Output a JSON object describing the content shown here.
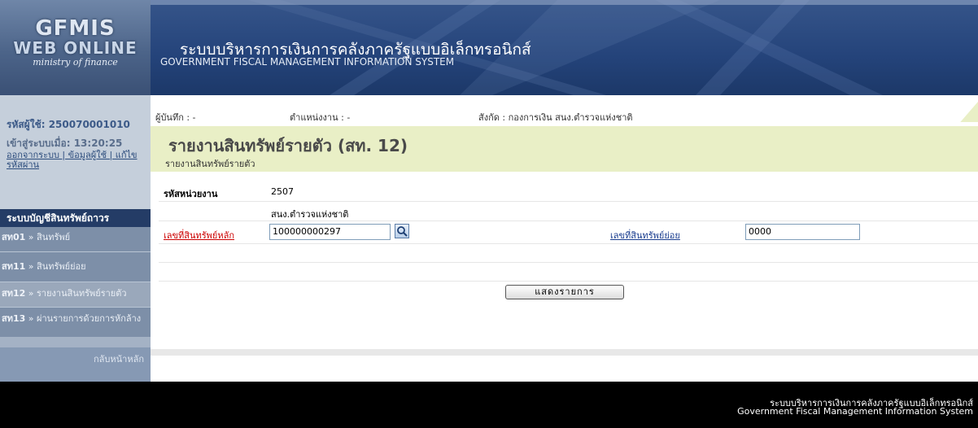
{
  "logo": {
    "line1": "GFMIS",
    "line2": "WEB ONLINE",
    "line3": "ministry of finance"
  },
  "banner": {
    "title_th": "ระบบบริหารการเงินการคลังภาครัฐแบบอิเล็กทรอนิกส์",
    "title_en": "GOVERNMENT FISCAL MANAGEMENT INFORMATION SYSTEM"
  },
  "user": {
    "id_label": "รหัสผู้ใช้: 250070001010",
    "login_label": "เข้าสู่ระบบเมื่อ:",
    "login_time": "13:20:25",
    "links": "ออกจากระบบ | ข้อมูลผู้ใช้ | แก้ไขรหัสผ่าน"
  },
  "menu": {
    "header": "ระบบบัญชีสินทรัพย์ถาวร",
    "items": [
      {
        "code": "สท01",
        "sep": " » ",
        "label": "สินทรัพย์"
      },
      {
        "code": "สท11",
        "sep": " » ",
        "label": "สินทรัพย์ย่อย"
      },
      {
        "code": "สท12",
        "sep": " » ",
        "label": "รายงานสินทรัพย์รายตัว"
      },
      {
        "code": "สท13",
        "sep": " » ",
        "label": "ผ่านรายการด้วยการหักล้าง"
      }
    ],
    "back_home": "กลับหน้าหลัก"
  },
  "infobar": {
    "recorder": "ผู้บันทึก : -",
    "position": "ตำแหน่งงาน : -",
    "affiliation": "สังกัด : กองการเงิน สนง.ตำรวจแห่งชาติ"
  },
  "page": {
    "title": "รายงานสินทรัพย์รายตัว (สท. 12)",
    "subtitle": "รายงานสินทรัพย์รายตัว"
  },
  "form": {
    "unit_code_label": "รหัสหน่วยงาน",
    "unit_code_value": "2507",
    "unit_name": "สนง.ตำรวจแห่งชาติ",
    "main_asset_label": "เลขที่สินทรัพย์หลัก",
    "main_asset_value": "100000000297",
    "sub_asset_label": "เลขที่สินทรัพย์ย่อย",
    "sub_asset_value": "0000",
    "show_button": "แสดงรายการ"
  },
  "footer": {
    "line_th": "ระบบบริหารการเงินการคลังภาครัฐแบบอิเล็กทรอนิกส์",
    "line_en": "Government Fiscal Management Information System"
  },
  "colors": {
    "menu_header": "#243c66",
    "title_box": "#e9efc6",
    "main_asset_label": "#cc0000",
    "sub_asset_label": "#1a3d8f"
  },
  "icons": {
    "search": "search-icon"
  }
}
